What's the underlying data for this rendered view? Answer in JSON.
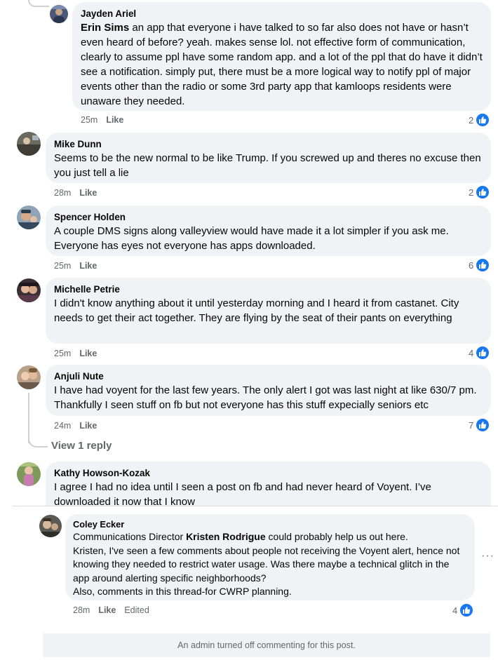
{
  "comments": [
    {
      "author": "Jayden Ariel",
      "mention": "Erin Sims",
      "text": " an app that everyone i have talked to so far also does not have or hasn’t even heard of before? yeah. makes sense lol. not effective form of communication, clearly to assume ppl have some random app. and a lot of the ppl that do have it didn’t see a notification. simply put, there must be a more logical way to notify ppl of major events other than the radio or some 3rd party app that kamloops residents were unaware they needed.",
      "time": "25m",
      "like_label": "Like",
      "reactions": "2"
    },
    {
      "author": "Mike Dunn",
      "text": "Seems to be the new normal to be like Trump. If you screwed up and theres no excuse then you just tell a lie",
      "time": "28m",
      "like_label": "Like",
      "reactions": "2"
    },
    {
      "author": "Spencer Holden",
      "text": "A couple DMS signs along valleyview would have made it a lot simpler if you ask me. Everyone has eyes not everyone has apps downloaded.",
      "time": "25m",
      "like_label": "Like",
      "reactions": "6"
    },
    {
      "author": "Michelle Petrie",
      "text": "I didn't know anything about it until yesterday morning and I heard it from castanet. City needs to get their act together. They are flying by the seat of their pants on everything",
      "time": "25m",
      "like_label": "Like",
      "reactions": "4"
    },
    {
      "author": "Anjuli Nute",
      "text": "I have had voyent for the last few years. The only alert I got was last night at like 630/7 pm. Thankfully I seen stuff on fb but not everyone has this stuff expecially seniors etc",
      "time": "24m",
      "like_label": "Like",
      "reactions": "7",
      "view_replies": "View 1 reply"
    },
    {
      "author": "Kathy Howson-Kozak",
      "text": "I agree I had no idea until I seen a post on fb and had never heard of Voyent. I’ve downloaded it now that I know"
    }
  ],
  "pinned_comment": {
    "author": "Coley Ecker",
    "line1_pre": "Communications Director ",
    "line1_mention": "Kristen Rodrigue",
    "line1_post": " could probably help us out here.",
    "line2": "Kristen, I've seen a few comments about people not receiving the Voyent alert, hence not knowing they needed to restrict water usage. Was there maybe a technical glitch in the app around alerting specific neighborhoods?",
    "line3": "Also, comments in this thread-for CWRP planning.",
    "time": "28m",
    "like_label": "Like",
    "edited_label": "Edited",
    "reactions": "4",
    "more_label": "···"
  },
  "footer_notice": "An admin turned off commenting for this post.",
  "colors": {
    "bubble": "#f0f2f5",
    "like_blue": "#1877f2",
    "meta_gray": "#65676b"
  }
}
